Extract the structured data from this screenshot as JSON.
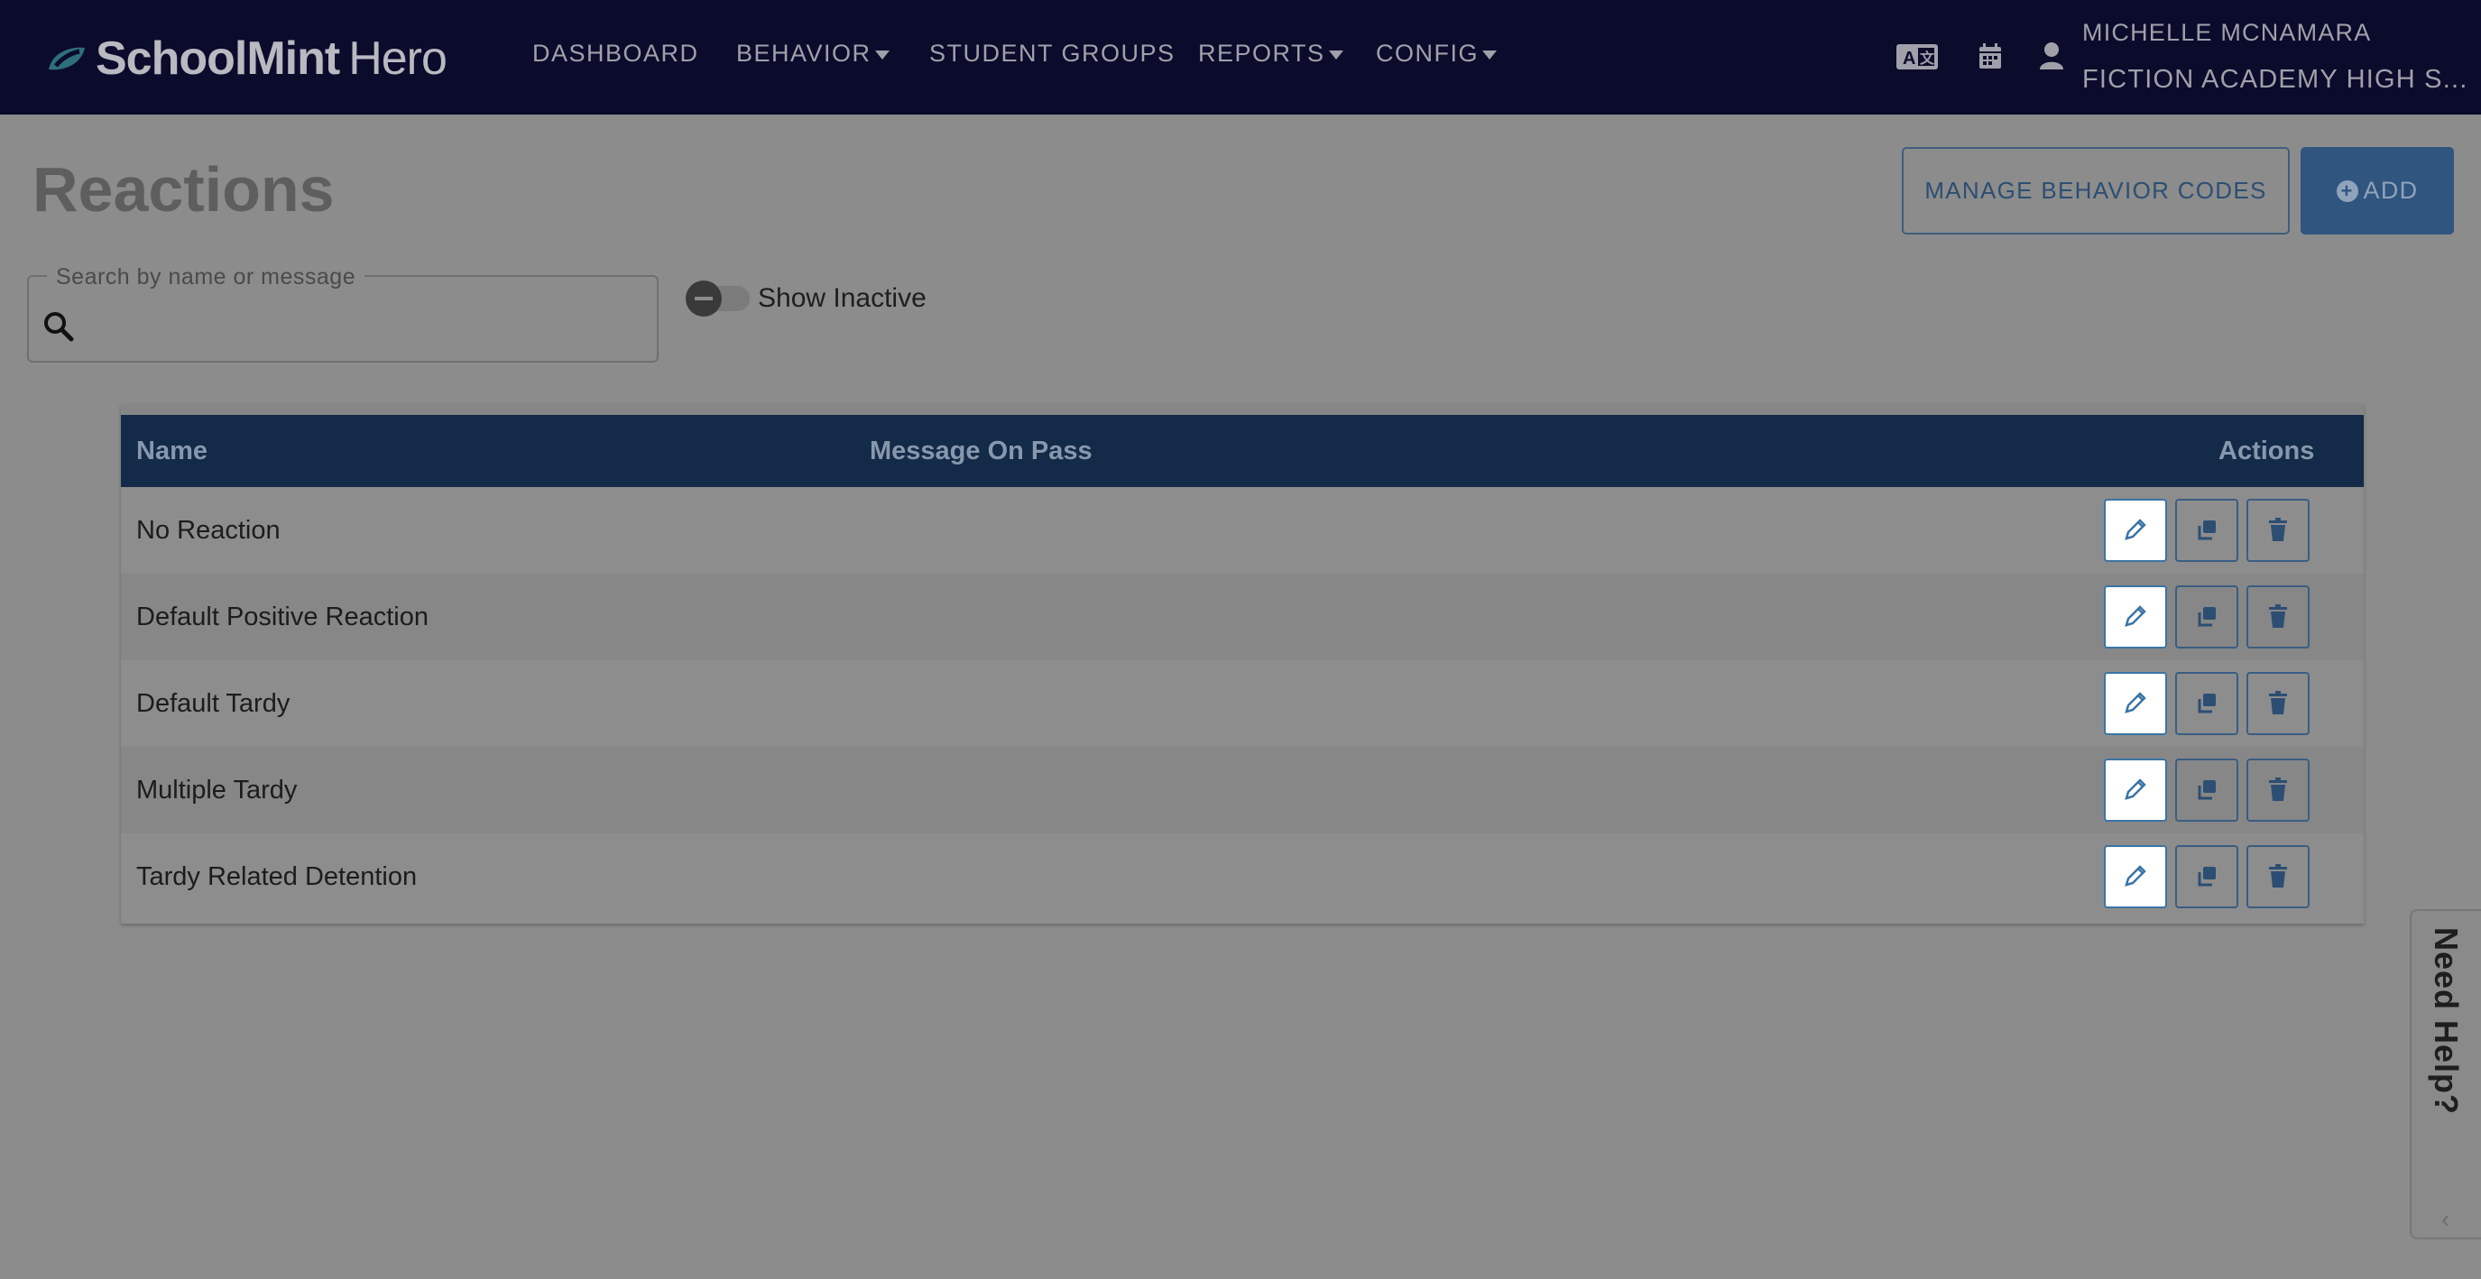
{
  "navbar": {
    "logo_brand": "SchoolMint",
    "logo_product": "Hero",
    "items": [
      {
        "label": "DASHBOARD",
        "dropdown": false
      },
      {
        "label": "BEHAVIOR",
        "dropdown": true
      },
      {
        "label": "STUDENT GROUPS",
        "dropdown": false
      },
      {
        "label": "REPORTS",
        "dropdown": true
      },
      {
        "label": "CONFIG",
        "dropdown": true
      }
    ],
    "icons": [
      "translate-icon",
      "calendar-icon",
      "user-icon"
    ],
    "user_name": "MICHELLE MCNAMARA",
    "school_name": "FICTION ACADEMY HIGH S..."
  },
  "page": {
    "title": "Reactions",
    "manage_button": "MANAGE BEHAVIOR CODES",
    "add_button": "ADD"
  },
  "search": {
    "legend": "Search by name or message",
    "value": ""
  },
  "toggle": {
    "label": "Show Inactive",
    "checked": false
  },
  "table": {
    "columns": [
      "Name",
      "Message On Pass",
      "Actions"
    ],
    "rows": [
      {
        "name": "No Reaction",
        "message": ""
      },
      {
        "name": "Default Positive Reaction",
        "message": ""
      },
      {
        "name": "Default Tardy",
        "message": ""
      },
      {
        "name": "Multiple Tardy",
        "message": ""
      },
      {
        "name": "Tardy Related Detention",
        "message": ""
      }
    ],
    "action_icons": [
      "pencil-icon",
      "copy-icon",
      "trash-icon"
    ]
  },
  "help": {
    "label": "Need Help?"
  },
  "colors": {
    "navbar_bg": "#0b0b2c",
    "table_header_bg": "#132a48",
    "accent": "#30557e",
    "overlay_bg": "#8c8c8c"
  }
}
